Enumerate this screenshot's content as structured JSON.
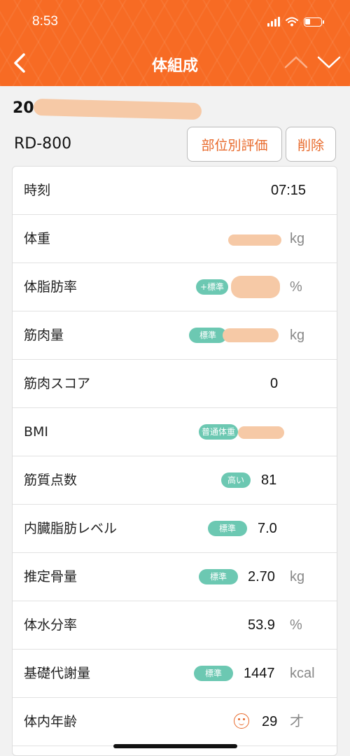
{
  "status_bar": {
    "time": "8:53"
  },
  "header": {
    "title": "体組成",
    "back_icon": "chevron-left-icon",
    "prev_icon": "chevron-up-icon",
    "next_icon": "chevron-down-icon"
  },
  "record": {
    "date_prefix": "20",
    "device": "RD-800",
    "eval_button": "部位別評価",
    "delete_button": "削除"
  },
  "rows": [
    {
      "label": "時刻",
      "value": "07:15",
      "unit": "",
      "badge": ""
    },
    {
      "label": "体重",
      "value": "",
      "unit": "kg",
      "badge": ""
    },
    {
      "label": "体脂肪率",
      "value": "",
      "unit": "%",
      "badge": "+標準"
    },
    {
      "label": "筋肉量",
      "value": "",
      "unit": "kg",
      "badge": "標準"
    },
    {
      "label": "筋肉スコア",
      "value": "0",
      "unit": "",
      "badge": ""
    },
    {
      "label": "BMI",
      "value": "",
      "unit": "",
      "badge": "普通体重"
    },
    {
      "label": "筋質点数",
      "value": "81",
      "unit": "",
      "badge": "高い"
    },
    {
      "label": "内臓脂肪レベル",
      "value": "7.0",
      "unit": "",
      "badge": "標準"
    },
    {
      "label": "推定骨量",
      "value": "2.70",
      "unit": "kg",
      "badge": "標準"
    },
    {
      "label": "体水分率",
      "value": "53.9",
      "unit": "%",
      "badge": ""
    },
    {
      "label": "基礎代謝量",
      "value": "1447",
      "unit": "kcal",
      "badge": "標準"
    },
    {
      "label": "体内年齢",
      "value": "29",
      "unit": "才",
      "badge": "",
      "icon": "face-icon"
    }
  ],
  "colors": {
    "header": "#f76b24",
    "accent": "#e8692a",
    "badge": "#6cc8b2"
  }
}
